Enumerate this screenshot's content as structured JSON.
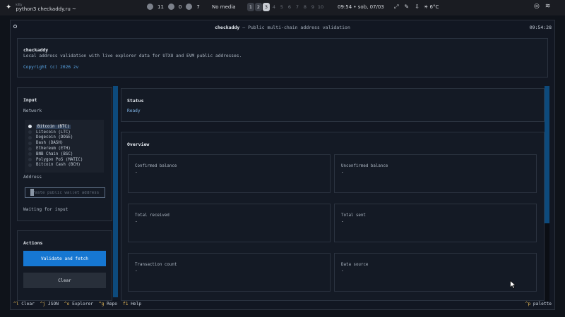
{
  "system_bar": {
    "app_small": "kitty",
    "app_title": "python3 checkaddy.ru ~",
    "stat1": "11",
    "stat2": "0",
    "stat3": "7",
    "media": "No media",
    "workspaces": [
      "1",
      "2",
      "3",
      "4",
      "5",
      "6",
      "7",
      "8",
      "9",
      "10"
    ],
    "active_workspace": "3",
    "clock": "09:54 • sob, 07/03",
    "weather": "6°C"
  },
  "window": {
    "title_app": "checkaddy",
    "title_rest": " — Public multi-chain address validation",
    "time": "09:54:28"
  },
  "header": {
    "name": "checkaddy",
    "description": "Local address validation with live explorer data for UTXO and EVM public addresses.",
    "copyright": "Copyright (c) 2026 zv"
  },
  "input": {
    "title": "Input",
    "network_label": "Network",
    "networks": [
      "Bitcoin (BTC)",
      "Litecoin (LTC)",
      "Dogecoin (DOGE)",
      "Dash (DASH)",
      "Ethereum (ETH)",
      "BNB Chain (BSC)",
      "Polygon PoS (MATIC)",
      "Bitcoin Cash (BCH)"
    ],
    "selected_network": "Bitcoin (BTC)",
    "address_label": "Address",
    "address_placeholder": "Paste public wallet address",
    "address_value": "",
    "waiting_text": "Waiting for input"
  },
  "actions": {
    "title": "Actions",
    "validate_label": "Validate and fetch",
    "clear_label": "Clear"
  },
  "status": {
    "title": "Status",
    "value": "Ready"
  },
  "overview": {
    "title": "Overview",
    "cards": [
      {
        "label": "Confirmed balance",
        "value": "-"
      },
      {
        "label": "Unconfirmed balance",
        "value": "-"
      },
      {
        "label": "Total received",
        "value": "-"
      },
      {
        "label": "Total sent",
        "value": "-"
      },
      {
        "label": "Transaction count",
        "value": "-"
      },
      {
        "label": "Data source",
        "value": "-"
      }
    ]
  },
  "footer": {
    "shortcuts": [
      {
        "key": "^l",
        "label": "Clear"
      },
      {
        "key": "^j",
        "label": "JSON"
      },
      {
        "key": "^o",
        "label": "Explorer"
      },
      {
        "key": "^g",
        "label": "Repo"
      },
      {
        "key": "f1",
        "label": "Help"
      }
    ],
    "palette_key": "^p",
    "palette_label": "palette"
  },
  "colors": {
    "accent": "#1677d2",
    "link": "#5aa7e8",
    "key_hint": "#e5ba5a",
    "background": "#0f131a"
  }
}
